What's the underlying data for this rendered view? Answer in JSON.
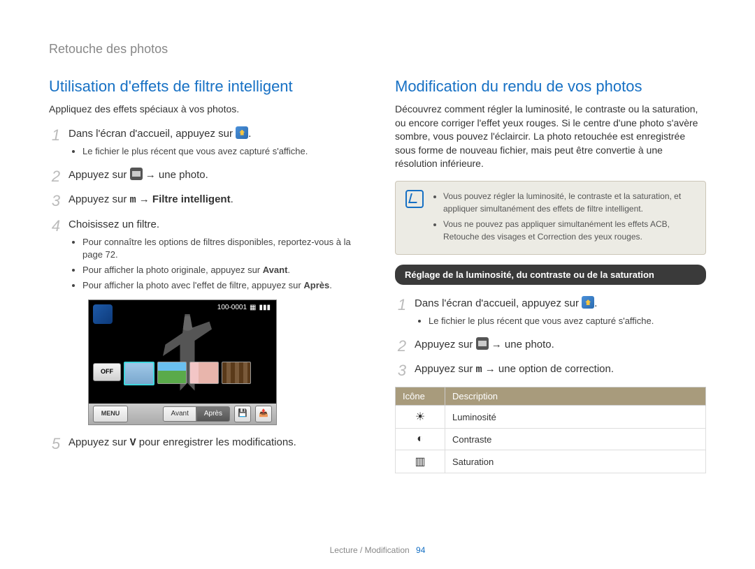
{
  "breadcrumb": "Retouche des photos",
  "footer": {
    "section": "Lecture / Modification",
    "page": "94"
  },
  "left": {
    "title": "Utilisation d'effets de filtre intelligent",
    "intro": "Appliquez des effets spéciaux à vos photos.",
    "step1": {
      "text": "Dans l'écran d'accueil, appuyez sur",
      "suffix": ".",
      "sub": "Le fichier le plus récent que vous avez capturé s'affiche."
    },
    "step2": {
      "prefix": "Appuyez sur",
      "arrow": "→ une photo."
    },
    "step3": {
      "prefix": "Appuyez sur",
      "menu_key": "m",
      "arrow": "→",
      "bold": "Filtre intelligent",
      "suffix": "."
    },
    "step4": {
      "text": "Choisissez un filtre.",
      "subs": [
        "Pour connaître les options de filtres disponibles, reportez-vous à la page 72.",
        {
          "pre": "Pour afficher la photo originale, appuyez sur ",
          "b": "Avant",
          "post": "."
        },
        {
          "pre": "Pour afficher la photo avec l'effet de filtre, appuyez sur ",
          "b": "Après",
          "post": "."
        }
      ]
    },
    "step5": {
      "prefix": "Appuyez sur",
      "key": "V",
      "rest": "pour enregistrer les modifications."
    },
    "screenshot": {
      "counter": "100-0001",
      "off": "OFF",
      "menu": "MENU",
      "avant": "Avant",
      "apres": "Après"
    }
  },
  "right": {
    "title": "Modification du rendu de vos photos",
    "intro": "Découvrez comment régler la luminosité, le contraste ou la saturation, ou encore corriger l'effet yeux rouges. Si le centre d'une photo s'avère sombre, vous pouvez l'éclaircir. La photo retouchée est enregistrée sous forme de nouveau fichier, mais peut être convertie à une résolution inférieure.",
    "notes": [
      "Vous pouvez régler la luminosité, le contraste et la saturation, et appliquer simultanément des effets de filtre intelligent.",
      "Vous ne pouvez pas appliquer simultanément les effets ACB, Retouche des visages et Correction des yeux rouges."
    ],
    "pill": "Réglage de la luminosité, du contraste ou de la saturation",
    "step1": {
      "text": "Dans l'écran d'accueil, appuyez sur",
      "suffix": ".",
      "sub": "Le fichier le plus récent que vous avez capturé s'affiche."
    },
    "step2": {
      "prefix": "Appuyez sur",
      "arrow": "→ une photo."
    },
    "step3": {
      "prefix": "Appuyez sur",
      "menu_key": "m",
      "arrow": "→ une option de correction."
    },
    "table": {
      "header": {
        "icon": "Icône",
        "desc": "Description"
      },
      "rows": [
        {
          "icon": "☀",
          "desc": "Luminosité"
        },
        {
          "icon": "◐",
          "desc": "Contraste"
        },
        {
          "icon": "▥",
          "desc": "Saturation"
        }
      ]
    }
  }
}
